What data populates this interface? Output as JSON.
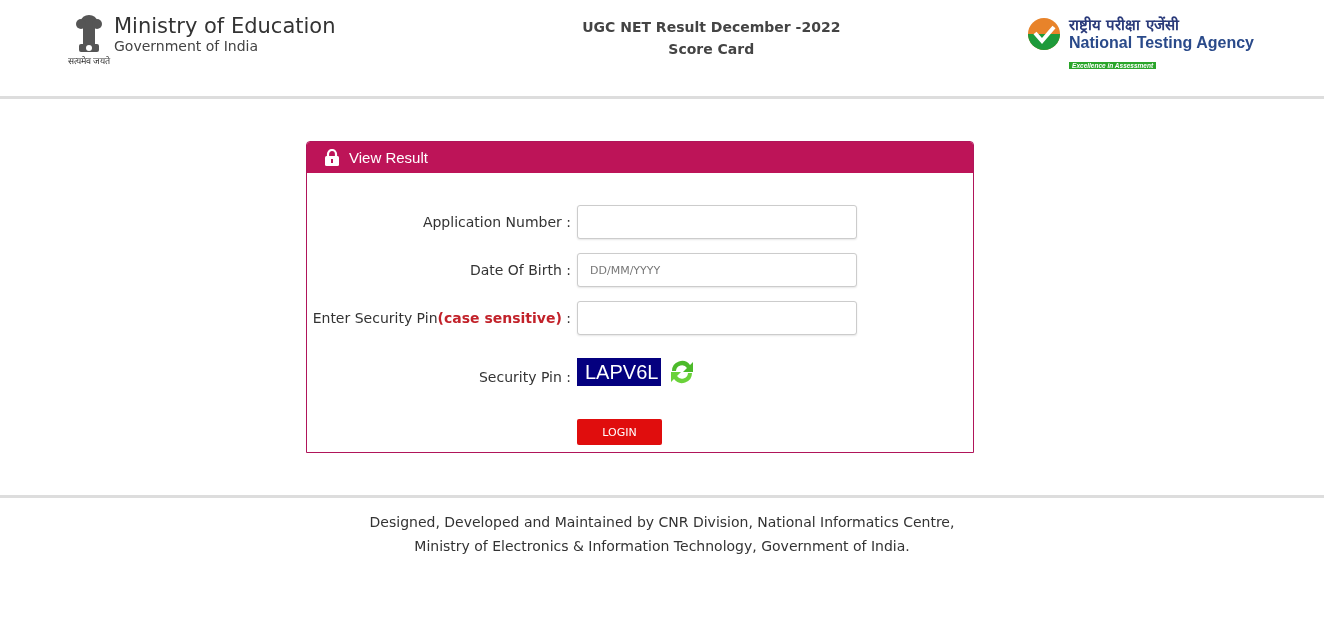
{
  "header": {
    "ministry": {
      "title": "Ministry of Education",
      "subtitle": "Government of India",
      "motto": "सत्यमेव जयते"
    },
    "page_title": [
      "UGC NET Result December -2022",
      "Score Card"
    ],
    "agency": {
      "hindi": "राष्ट्रीय परीक्षा एजेंसी",
      "name": "National Testing Agency",
      "tagline": "Excellence in Assessment"
    }
  },
  "card": {
    "title": "View Result",
    "fields": [
      {
        "kind": "input",
        "label": "Application Number :"
      },
      {
        "kind": "input",
        "label": "Date Of Birth :",
        "placeholder": "DD/MM/YYYY"
      },
      {
        "kind": "input",
        "label": "Enter Security Pin**(case sensitive)** :"
      },
      {
        "kind": "captcha",
        "label": "Security Pin :",
        "value": "LAPV6L"
      }
    ],
    "button": "LOGIN"
  },
  "footer": [
    "Designed, Developed and Maintained by CNR Division, National Informatics Centre,",
    "Ministry of Electronics & Information Technology, Government of India."
  ]
}
